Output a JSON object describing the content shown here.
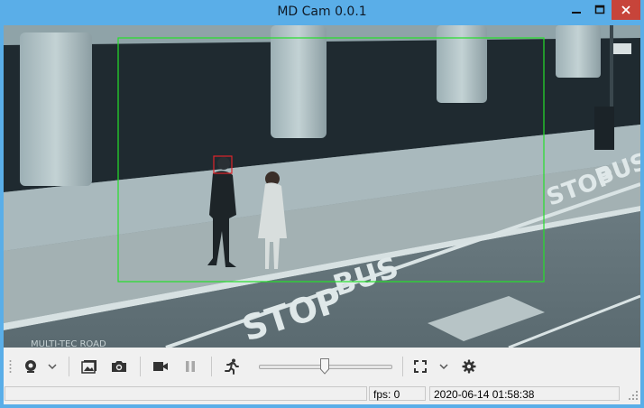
{
  "window": {
    "title": "MD Cam 0.0.1"
  },
  "video": {
    "street_text": [
      "BUS",
      "STOP",
      "BUS",
      "STOP"
    ],
    "scene_text": "MULTI-TEC ROAD"
  },
  "toolbar": {
    "camera_icon": "webcam-icon",
    "slider_level": 0.5
  },
  "statusbar": {
    "message": "",
    "fps": "fps: 0",
    "datetime": "2020-06-14 01:58:38"
  },
  "colors": {
    "titlebar": "#5aaee8",
    "close": "#c7443a",
    "motion_area": "#25e02b",
    "face_box": "#e0242a"
  }
}
